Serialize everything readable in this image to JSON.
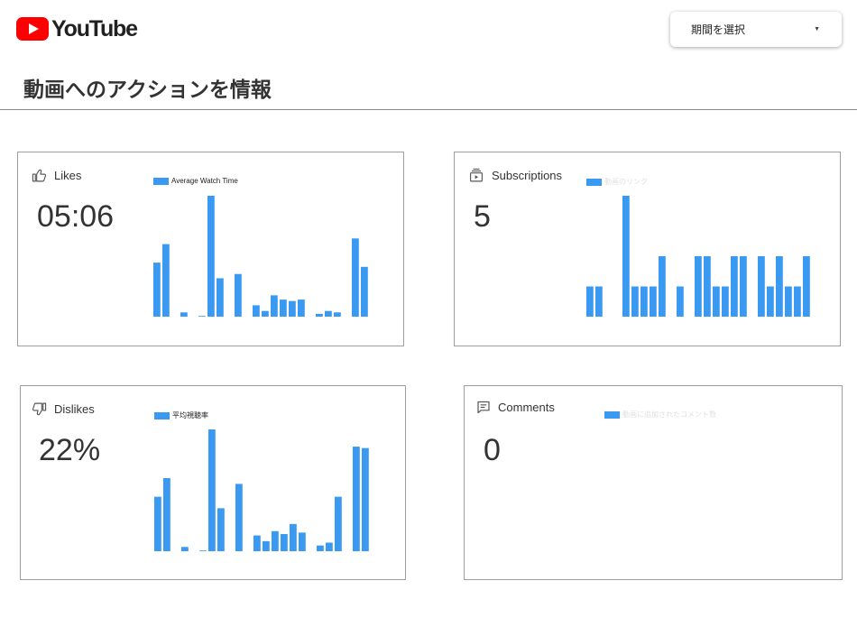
{
  "header": {
    "logo_text": "YouTube",
    "period_select": {
      "selected": "期間を選択"
    }
  },
  "page": {
    "title": "動画へのアクションを情報"
  },
  "colors": {
    "bar": "#3a9af2",
    "accent_red": "#ff0000"
  },
  "cards": [
    {
      "id": "likes",
      "icon": "thumbs-up-icon",
      "label": "Likes",
      "value": "05:06",
      "legend": "Average Watch Time",
      "legend_color": "#212121",
      "chart_data": {
        "type": "bar",
        "series": [
          {
            "name": "Average Watch Time",
            "values": [
              38,
              51,
              0,
              3,
              0,
              0.5,
              85,
              27,
              0,
              30,
              0,
              8,
              4,
              15,
              12,
              11,
              12,
              0,
              2,
              4,
              3,
              0,
              55,
              35
            ]
          }
        ],
        "ylim": [
          0,
          85
        ]
      }
    },
    {
      "id": "subscriptions",
      "icon": "subscriptions-icon",
      "label": "Subscriptions",
      "value": "5",
      "legend": "動画のリンク",
      "legend_color": "#e0e0e0",
      "chart_data": {
        "type": "bar",
        "series": [
          {
            "name": "動画のリンク",
            "values": [
              1,
              1,
              0,
              0,
              4,
              1,
              1,
              1,
              2,
              0,
              1,
              0,
              2,
              2,
              1,
              1,
              2,
              2,
              0,
              2,
              1,
              2,
              1,
              1,
              2
            ]
          }
        ],
        "ylim": [
          0,
          4
        ]
      }
    },
    {
      "id": "dislikes",
      "icon": "thumbs-down-icon",
      "label": "Dislikes",
      "value": "22%",
      "legend": "平均視聴率",
      "legend_color": "#212121",
      "chart_data": {
        "type": "bar",
        "series": [
          {
            "name": "平均視聴率",
            "values": [
              38,
              51,
              0,
              3,
              0,
              0.5,
              85,
              30,
              0,
              47,
              0,
              11,
              7,
              14,
              12,
              19,
              13,
              0,
              4,
              6,
              38,
              0,
              73,
              72
            ]
          }
        ],
        "ylim": [
          0,
          85
        ]
      }
    },
    {
      "id": "comments",
      "icon": "comment-icon",
      "label": "Comments",
      "value": "0",
      "legend": "動画に追加されたコメント数",
      "legend_color": "#e0e0e0",
      "chart_data": {
        "type": "bar",
        "series": [
          {
            "name": "動画に追加されたコメント数",
            "values": []
          }
        ],
        "ylim": [
          0,
          1
        ]
      }
    }
  ]
}
